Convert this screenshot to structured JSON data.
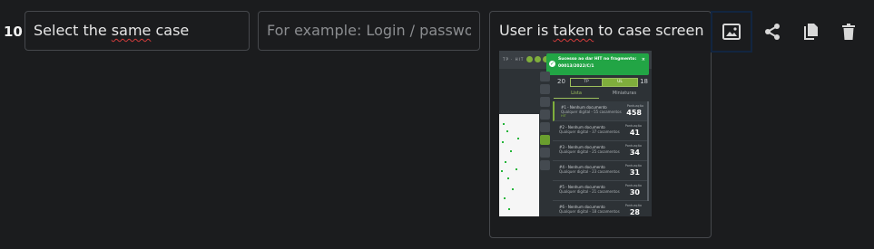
{
  "step": {
    "number": "10",
    "action_prefix": "Select the ",
    "action_misspelled": "same",
    "action_suffix": " case",
    "data_placeholder": "For example: Login / password",
    "data_value": "",
    "result_prefix": "User is ",
    "result_misspelled": "taken",
    "result_suffix": " to case screen"
  },
  "thumbnail": {
    "logo": "TP · HIT",
    "toast_line1": "Sucesso ao dar HIT no fragmento:",
    "toast_line2": "00013/2022/C/1",
    "toast_close": "×",
    "toast_check": "✓",
    "page_left": "20",
    "page_right": "18",
    "seg_left": "TP",
    "seg_right": "UL",
    "tab_list": "Lista",
    "tab_thumbs": "Miniaturas",
    "score_label": "Pontuação",
    "rows": [
      {
        "l1": "#1 - Nenhum documento",
        "l2": "Qualquer digital - 55 casamentos",
        "l3": "HIT",
        "score": "458"
      },
      {
        "l1": "#2 - Nenhum documento",
        "l2": "Qualquer digital - 37 casamentos",
        "l3": "",
        "score": "41"
      },
      {
        "l1": "#3 - Nenhum documento",
        "l2": "Qualquer digital - 25 casamentos",
        "l3": "",
        "score": "34"
      },
      {
        "l1": "#4 - Nenhum documento",
        "l2": "Qualquer digital - 23 casamentos",
        "l3": "",
        "score": "31"
      },
      {
        "l1": "#5 - Nenhum documento",
        "l2": "Qualquer digital - 21 casamentos",
        "l3": "",
        "score": "30"
      },
      {
        "l1": "#6 - Nenhum documento",
        "l2": "Qualquer digital - 18 casamentos",
        "l3": "",
        "score": "28"
      }
    ]
  },
  "actions": {
    "image_icon": "image-icon",
    "share_icon": "share-icon",
    "copy_icon": "copy-icon",
    "delete_icon": "trash-icon",
    "focus_border_color": "#122540"
  }
}
